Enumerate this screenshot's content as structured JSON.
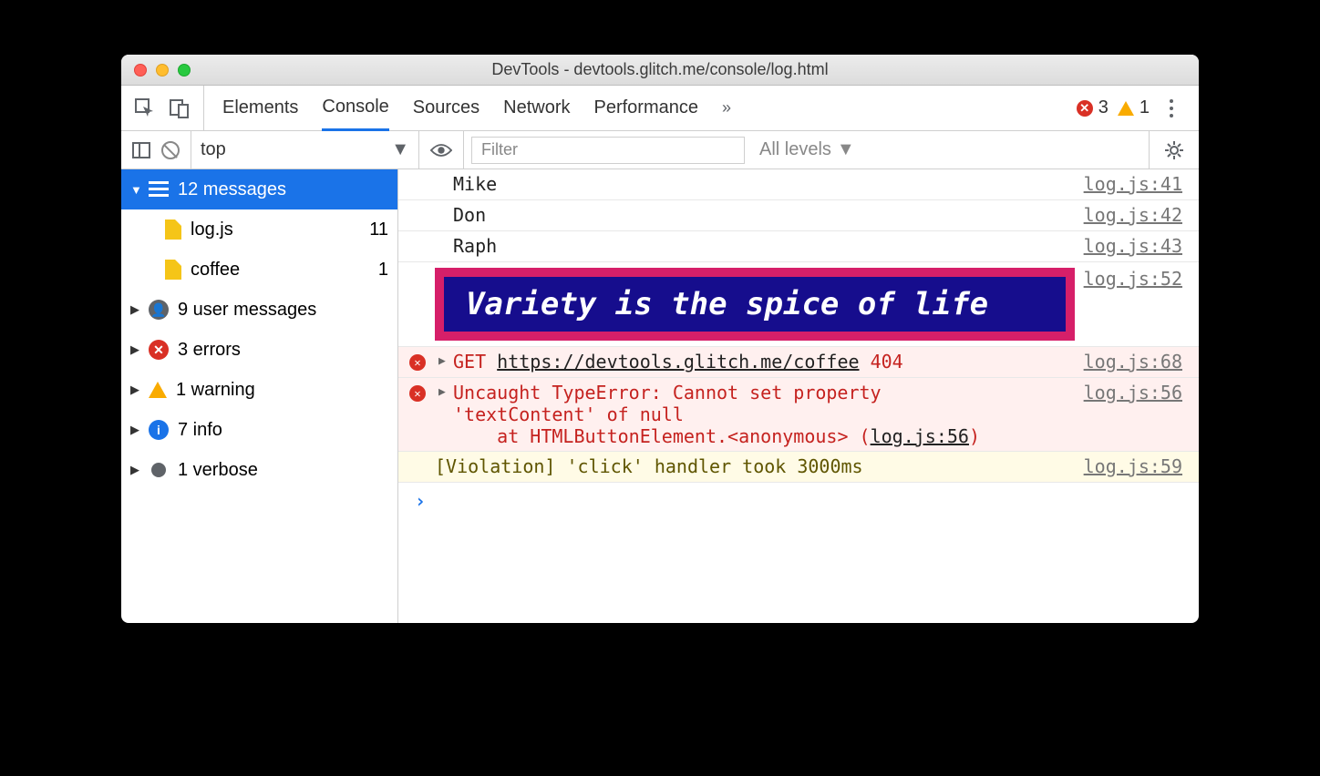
{
  "window": {
    "title": "DevTools - devtools.glitch.me/console/log.html"
  },
  "tabs": {
    "items": [
      "Elements",
      "Console",
      "Sources",
      "Network",
      "Performance"
    ],
    "more": "»",
    "errors": "3",
    "warnings": "1"
  },
  "filterbar": {
    "context": "top",
    "filter_placeholder": "Filter",
    "levels": "All levels"
  },
  "sidebar": {
    "messages": {
      "label": "12 messages"
    },
    "files": [
      {
        "name": "log.js",
        "count": "11"
      },
      {
        "name": "coffee",
        "count": "1"
      }
    ],
    "groups": [
      {
        "label": "9 user messages",
        "type": "user"
      },
      {
        "label": "3 errors",
        "type": "error"
      },
      {
        "label": "1 warning",
        "type": "warning"
      },
      {
        "label": "7 info",
        "type": "info"
      },
      {
        "label": "1 verbose",
        "type": "verbose"
      }
    ]
  },
  "console": {
    "rows": [
      {
        "text": "Mike",
        "src": "log.js:41"
      },
      {
        "text": "Don",
        "src": "log.js:42"
      },
      {
        "text": "Raph",
        "src": "log.js:43"
      }
    ],
    "styled": {
      "text": "Variety is the spice of life",
      "src": "log.js:52"
    },
    "err_get": {
      "method": "GET",
      "url": "https://devtools.glitch.me/coffee",
      "status": "404",
      "src": "log.js:68"
    },
    "err_type": {
      "msg1": "Uncaught TypeError: Cannot set property",
      "msg2": "'textContent' of null",
      "stack_prefix": "at HTMLButtonElement.",
      "stack_fn": "<anonymous>",
      "stack_loc": "log.js:56",
      "src": "log.js:56"
    },
    "violation": {
      "text": "[Violation] 'click' handler took 3000ms",
      "src": "log.js:59"
    },
    "prompt": "›"
  }
}
